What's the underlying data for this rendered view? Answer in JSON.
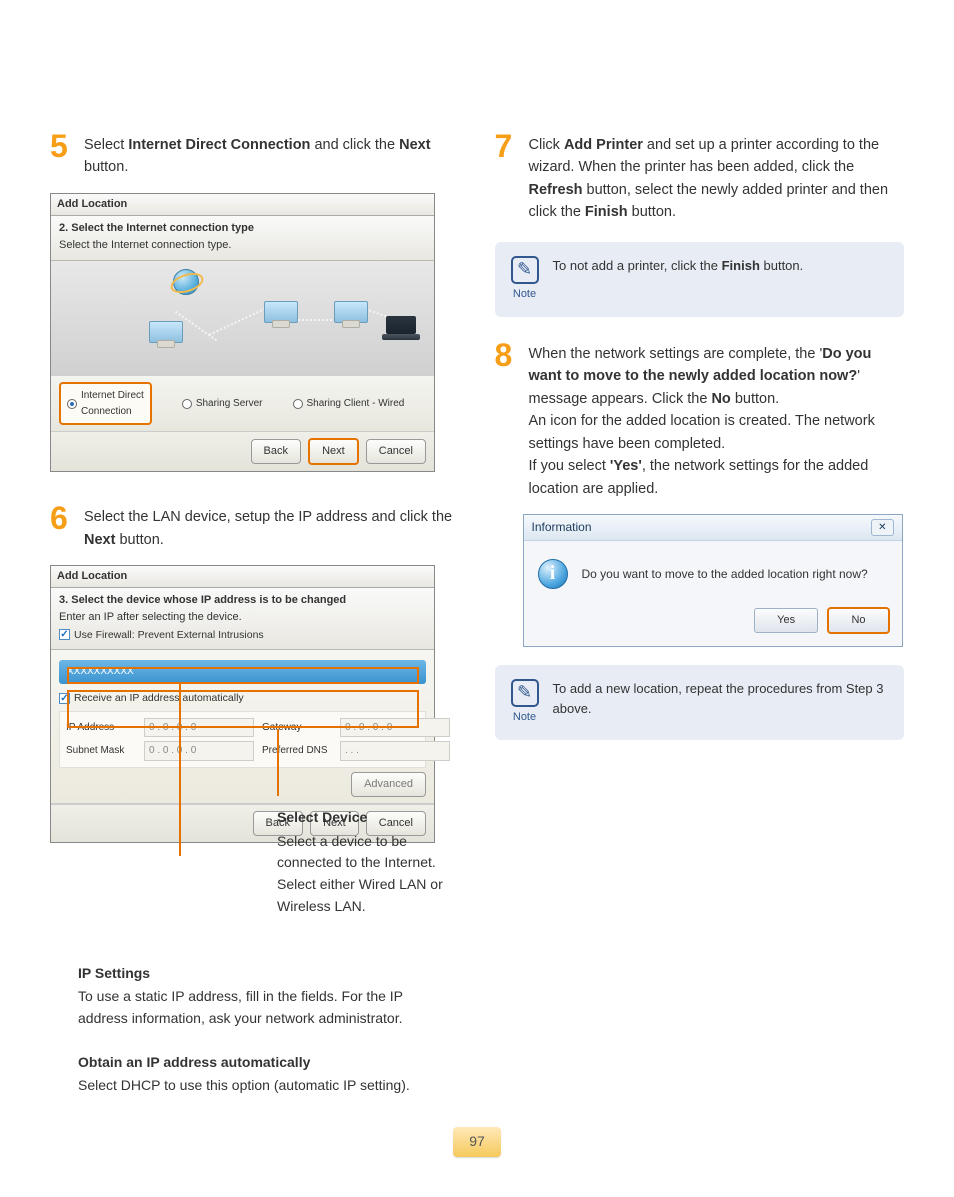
{
  "page_number": "97",
  "left": {
    "step5": {
      "num": "5",
      "text_pre": "Select ",
      "bold1": "Internet Direct Connection",
      "text_mid": " and click the ",
      "bold2": "Next",
      "text_post": " button."
    },
    "wizard5": {
      "title": "Add Location",
      "sub_line1": "2. Select the Internet connection type",
      "sub_line2": "Select the Internet connection type.",
      "opt1_a": "Internet Direct",
      "opt1_b": "Connection",
      "opt2": "Sharing Server",
      "opt3": "Sharing Client - Wired",
      "back": "Back",
      "next": "Next",
      "cancel": "Cancel"
    },
    "step6": {
      "num": "6",
      "text_pre": "Select the LAN device, setup the IP address and click the ",
      "bold1": "Next",
      "text_post": " button."
    },
    "wizard6": {
      "title": "Add Location",
      "sub_line1": "3. Select the device whose IP address is to be changed",
      "sub_line2": "Enter an IP after selecting the device.",
      "chk_firewall": "Use Firewall: Prevent External Intrusions",
      "device": "XXXXXXXXXX",
      "chk_auto": "Receive an IP address automatically",
      "lbl_ip": "IP Address",
      "lbl_mask": "Subnet Mask",
      "lbl_gw": "Gateway",
      "lbl_dns": "Preferred DNS",
      "ip_zero": "0  .  0  .  0  .  0",
      "ip_blank": ".        .        .",
      "advanced": "Advanced",
      "back": "Back",
      "next": "Next",
      "cancel": "Cancel"
    },
    "annot_device": {
      "title": "Select Device",
      "body": "Select a device to be connected to the Internet. Select either Wired LAN or Wireless LAN."
    },
    "annot_ip": {
      "title": "IP Settings",
      "body": "To use a static IP address, fill in the fields. For the IP address information, ask your network administrator."
    },
    "annot_auto": {
      "title": "Obtain an IP address automatically",
      "body": "Select DHCP to use this option (automatic IP setting)."
    }
  },
  "right": {
    "step7": {
      "num": "7",
      "t1": "Click ",
      "b1": "Add Printer",
      "t2": " and set up a printer according to the wizard. When the printer has been added, click the ",
      "b2": "Refresh",
      "t3": " button, select the newly added printer and then click the ",
      "b3": "Finish",
      "t4": " button."
    },
    "note1": {
      "label": "Note",
      "t1": "To not add a printer, click the ",
      "b1": "Finish",
      "t2": " button."
    },
    "step8": {
      "num": "8",
      "t1": "When the network settings are complete, the '",
      "b1": "Do you want to move to the newly added location now?",
      "t2": "' message appears. Click the ",
      "b2": "No",
      "t3": " button.",
      "p2": "An icon for the added location is created. The network settings have been completed.",
      "t4": "If you select ",
      "b3": "'Yes'",
      "t5": ", the network settings for the added location are applied."
    },
    "info": {
      "title": "Information",
      "close": "✕",
      "msg": "Do you want to move to the added location right now?",
      "yes": "Yes",
      "no": "No"
    },
    "note2": {
      "label": "Note",
      "body": "To add a new location, repeat the procedures from Step 3 above."
    }
  }
}
